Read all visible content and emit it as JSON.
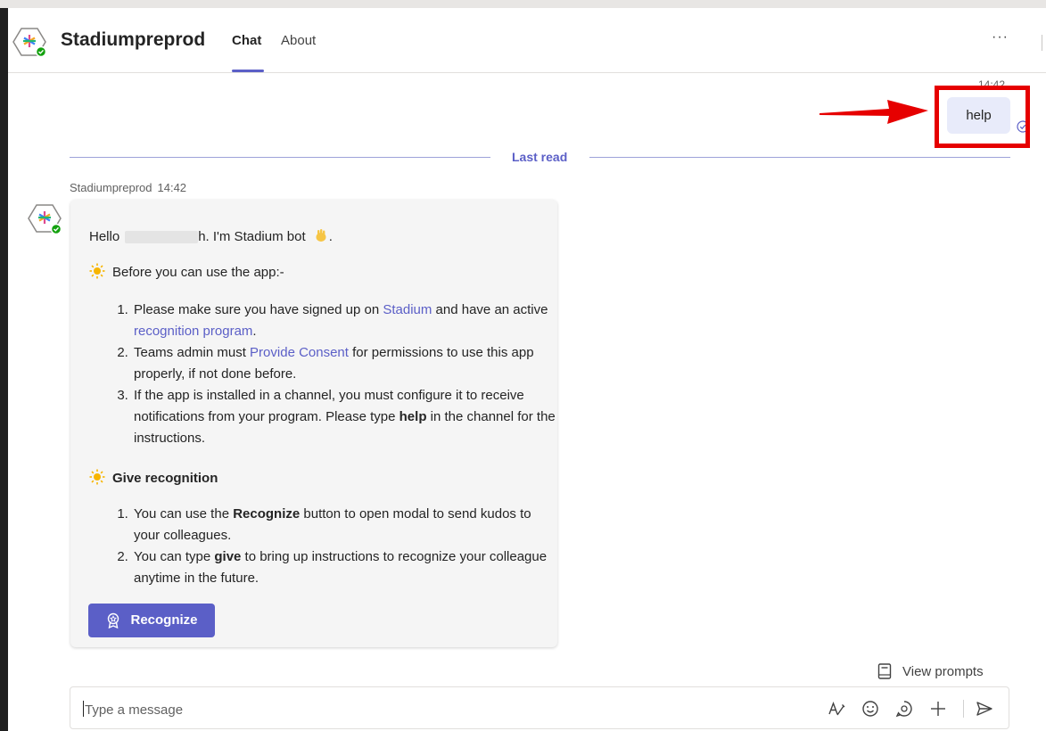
{
  "header": {
    "app_name": "Stadiumpreprod",
    "tabs": [
      {
        "label": "Chat",
        "active": true
      },
      {
        "label": "About",
        "active": false
      }
    ],
    "more_label": "···"
  },
  "sent_message": {
    "time": "14:42",
    "text": "help",
    "status_icon": "read-receipt-icon"
  },
  "divider": {
    "label": "Last read"
  },
  "bot_message": {
    "sender": "Stadiumpreprod",
    "time": "14:42",
    "greeting_prefix": "Hello",
    "greeting_suffix": "h. I'm Stadium bot",
    "section1_title": "Before you can use the app:-",
    "list1": {
      "item1_a": "Please make sure you have signed up on ",
      "item1_link1": "Stadium",
      "item1_b": " and have an active ",
      "item1_link2": "recognition program",
      "item1_c": ".",
      "item2_a": "Teams admin must ",
      "item2_link": "Provide Consent",
      "item2_b": " for permissions to use this app properly, if not done before.",
      "item3_a": "If the app is installed in a channel, you must configure it to receive notifications from your program. Please type ",
      "item3_bold": "help",
      "item3_b": " in the channel for the instructions."
    },
    "section2_title": "Give recognition",
    "list2": {
      "item1_a": "You can use the ",
      "item1_bold": "Recognize",
      "item1_b": " button to open modal to send kudos to your colleagues.",
      "item2_a": "You can type ",
      "item2_bold": "give",
      "item2_b": " to bring up instructions to recognize your colleague anytime in the future."
    },
    "button_label": "Recognize"
  },
  "footer": {
    "view_prompts": "View prompts",
    "composer_placeholder": "Type a message",
    "icons": [
      "format-icon",
      "emoji-icon",
      "loop-icon",
      "add-icon",
      "send-icon"
    ]
  },
  "colors": {
    "accent": "#5b5fc7",
    "highlight": "#e60000",
    "sent_bubble": "#e8ebfa"
  }
}
